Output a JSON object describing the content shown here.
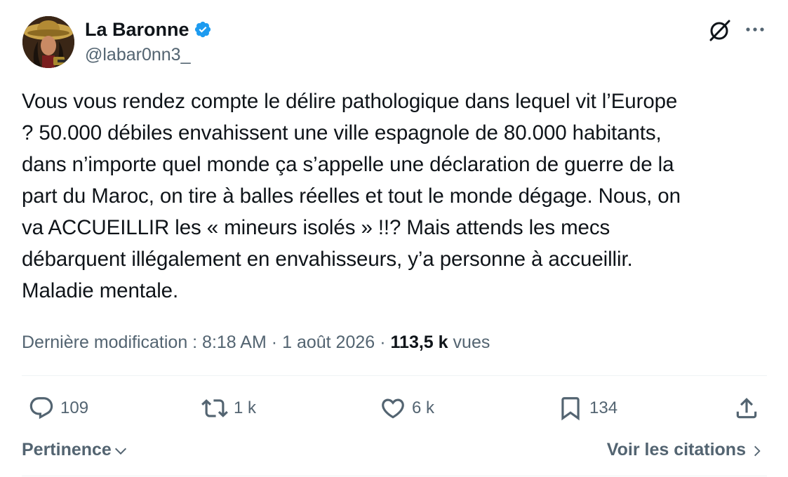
{
  "author": {
    "display_name": "La Baronne",
    "handle": "@labar0nn3_",
    "verified": true,
    "avatar_icon": "avatar-photo"
  },
  "header_icons": {
    "grok": "grok-icon",
    "more": "more-icon"
  },
  "tweet": {
    "text": "Vous vous rendez compte le délire pathologique dans lequel vit l’Europe\n? 50.000 débiles envahissent une ville espagnole de 80.000 habitants,\ndans n’importe quel monde ça s’appelle une déclaration de guerre de la\npart du Maroc, on tire à balles réelles et tout le monde dégage. Nous, on\nva ACCUEILLIR les « mineurs isolés » !!? Mais attends les mecs\ndébarquent illégalement en envahisseurs, y’a personne à accueillir.\nMaladie mentale."
  },
  "meta": {
    "edited_label": "Dernière modification : 8:18 AM",
    "separator": "·",
    "date": "1 août 2026",
    "views_count": "113,5 k",
    "views_label": "vues"
  },
  "actions": {
    "replies": "109",
    "reposts": "1 k",
    "likes": "6 k",
    "bookmarks": "134"
  },
  "footer": {
    "sort_label": "Pertinence",
    "quotes_label": "Voir les citations"
  },
  "colors": {
    "text": "#0f1419",
    "secondary": "#536471",
    "verified": "#1d9bf0",
    "divider": "#eff3f4"
  }
}
